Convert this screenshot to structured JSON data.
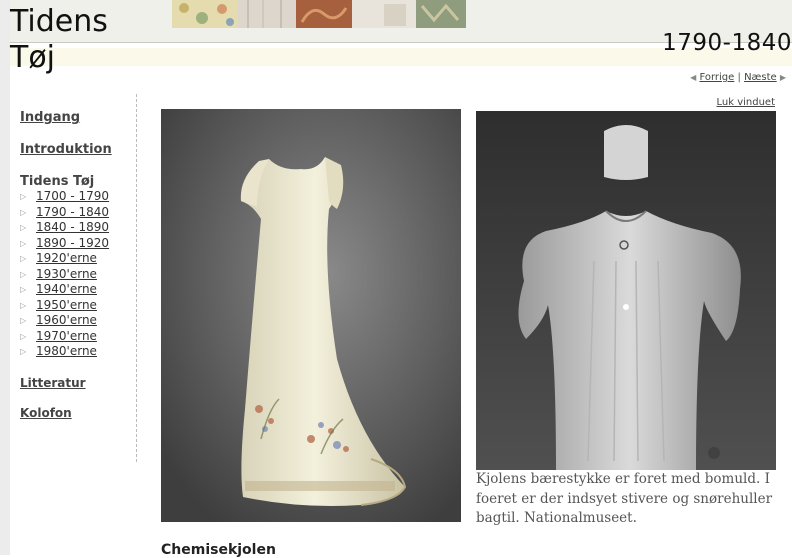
{
  "site": {
    "title_line1": "Tidens",
    "title_line2": "Tøj",
    "period": "1790-1840"
  },
  "topnav": {
    "prev": "Forrige",
    "separator": "|",
    "next": "Næste"
  },
  "close_window": "Luk vinduet",
  "sidebar": {
    "entrance": "Indgang",
    "introduction": "Introduktion",
    "section_heading": "Tidens Tøj",
    "periods": [
      "1700 - 1790",
      "1790 - 1840",
      "1840 - 1890",
      "1890 - 1920",
      "1920'erne",
      "1930'erne",
      "1940'erne",
      "1950'erne",
      "1960'erne",
      "1970'erne",
      "1980'erne"
    ],
    "literature": "Litteratur",
    "colophon": "Kolofon"
  },
  "caption": "Kjolens bærestykke er foret med bomuld. I foeret er der indsyet stivere og snørehuller bagtil. Nationalmuseet.",
  "section_title": "Chemisekjolen",
  "colors": {
    "header_band": "#f0f0ea",
    "header_yellow": "#fbfaea",
    "link": "#444444",
    "caption_text": "#555555"
  },
  "icons": {
    "prev": "triangle-left-icon",
    "next": "triangle-right-icon",
    "list_bullet": "triangle-right-icon"
  }
}
